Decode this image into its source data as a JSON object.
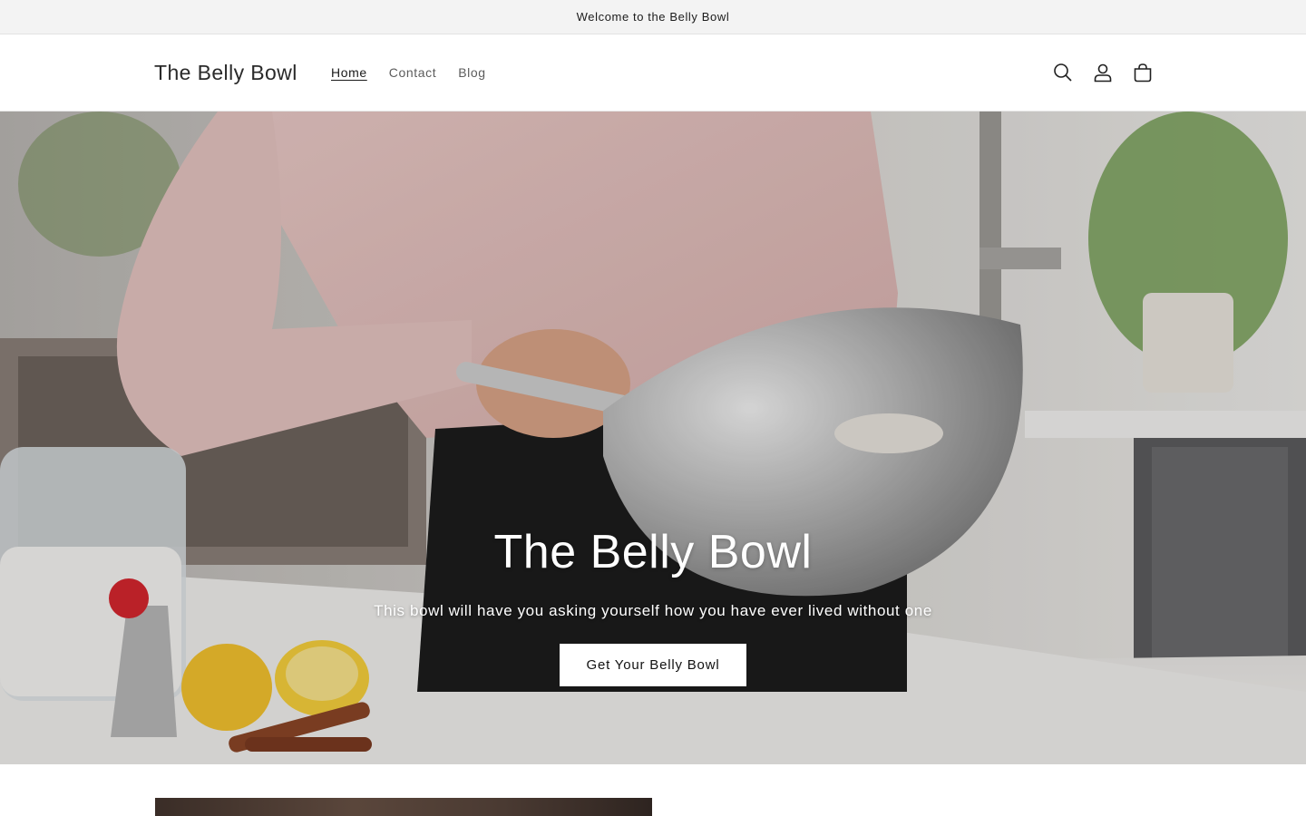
{
  "announcement": {
    "text": "Welcome to the Belly Bowl"
  },
  "header": {
    "logo": "The Belly Bowl",
    "nav": [
      {
        "label": "Home",
        "active": true
      },
      {
        "label": "Contact",
        "active": false
      },
      {
        "label": "Blog",
        "active": false
      }
    ],
    "icons": [
      "search-icon",
      "account-icon",
      "cart-icon"
    ]
  },
  "hero": {
    "title": "The Belly Bowl",
    "subtitle": "This bowl will have you asking yourself how you have ever lived without one",
    "button_label": "Get Your Belly Bowl"
  },
  "colors": {
    "announcement_bg": "#f3f3f3",
    "button_bg": "#ffffff",
    "text": "#121212"
  }
}
